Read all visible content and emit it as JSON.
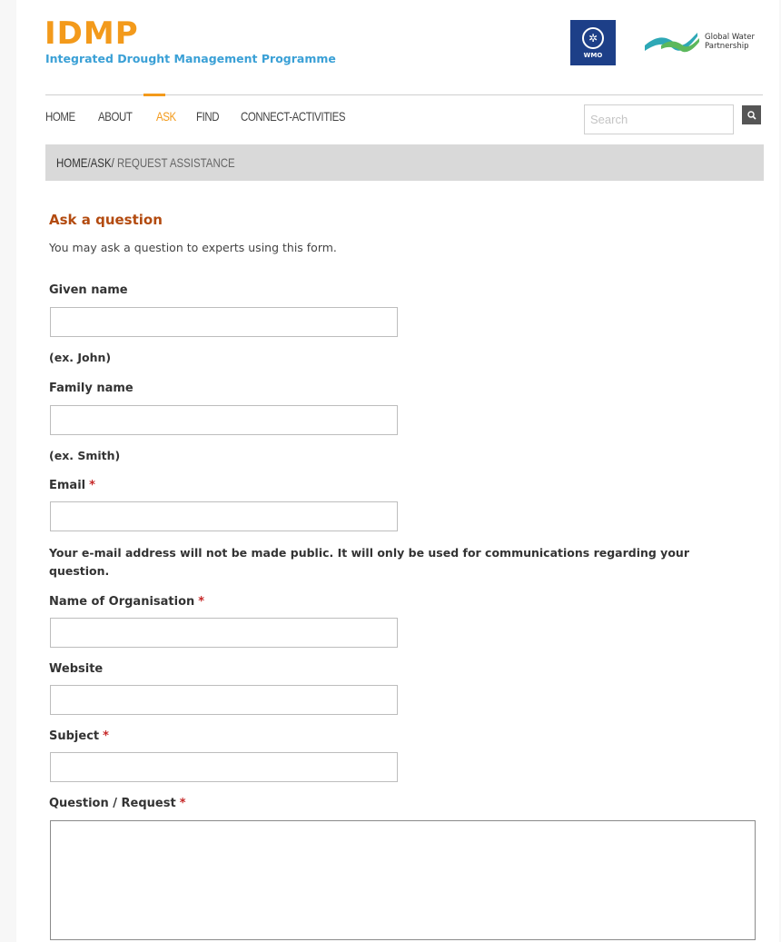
{
  "header": {
    "logo_title": "IDMP",
    "logo_subtitle": "Integrated Drought Management Programme",
    "wmo_label": "WMO",
    "gwp_label": "Global Water\nPartnership",
    "colors": {
      "brand_orange": "#f39a1b",
      "brand_blue": "#3aa0d6",
      "wmo_blue": "#1d3f88",
      "heading_brown": "#b34b10",
      "required_red": "#c62828"
    }
  },
  "nav": {
    "items": [
      {
        "label": "HOME",
        "active": false
      },
      {
        "label": "ABOUT",
        "active": false
      },
      {
        "label": "ASK",
        "active": true
      },
      {
        "label": "FIND",
        "active": false
      },
      {
        "label": "CONNECT-ACTIVITIES",
        "active": false
      }
    ],
    "search_placeholder": "Search",
    "search_icon": "search-icon"
  },
  "breadcrumb": {
    "home": "HOME",
    "ask": "ASK",
    "current": "REQUEST ASSISTANCE",
    "sep": "/"
  },
  "form": {
    "heading": "Ask a question",
    "intro": "You may ask a question to experts using this form.",
    "required_mark": "*",
    "given_name": {
      "label": "Given name",
      "value": "",
      "hint": "(ex. John)"
    },
    "family_name": {
      "label": "Family name",
      "value": "",
      "hint": "(ex. Smith)"
    },
    "email": {
      "label": "Email",
      "value": "",
      "note": "Your e-mail address will not be made public. It will only be used for communications regarding your question."
    },
    "organisation": {
      "label": "Name of Organisation",
      "value": ""
    },
    "website": {
      "label": "Website",
      "value": ""
    },
    "subject": {
      "label": "Subject",
      "value": ""
    },
    "question": {
      "label": "Question / Request",
      "value": ""
    }
  }
}
